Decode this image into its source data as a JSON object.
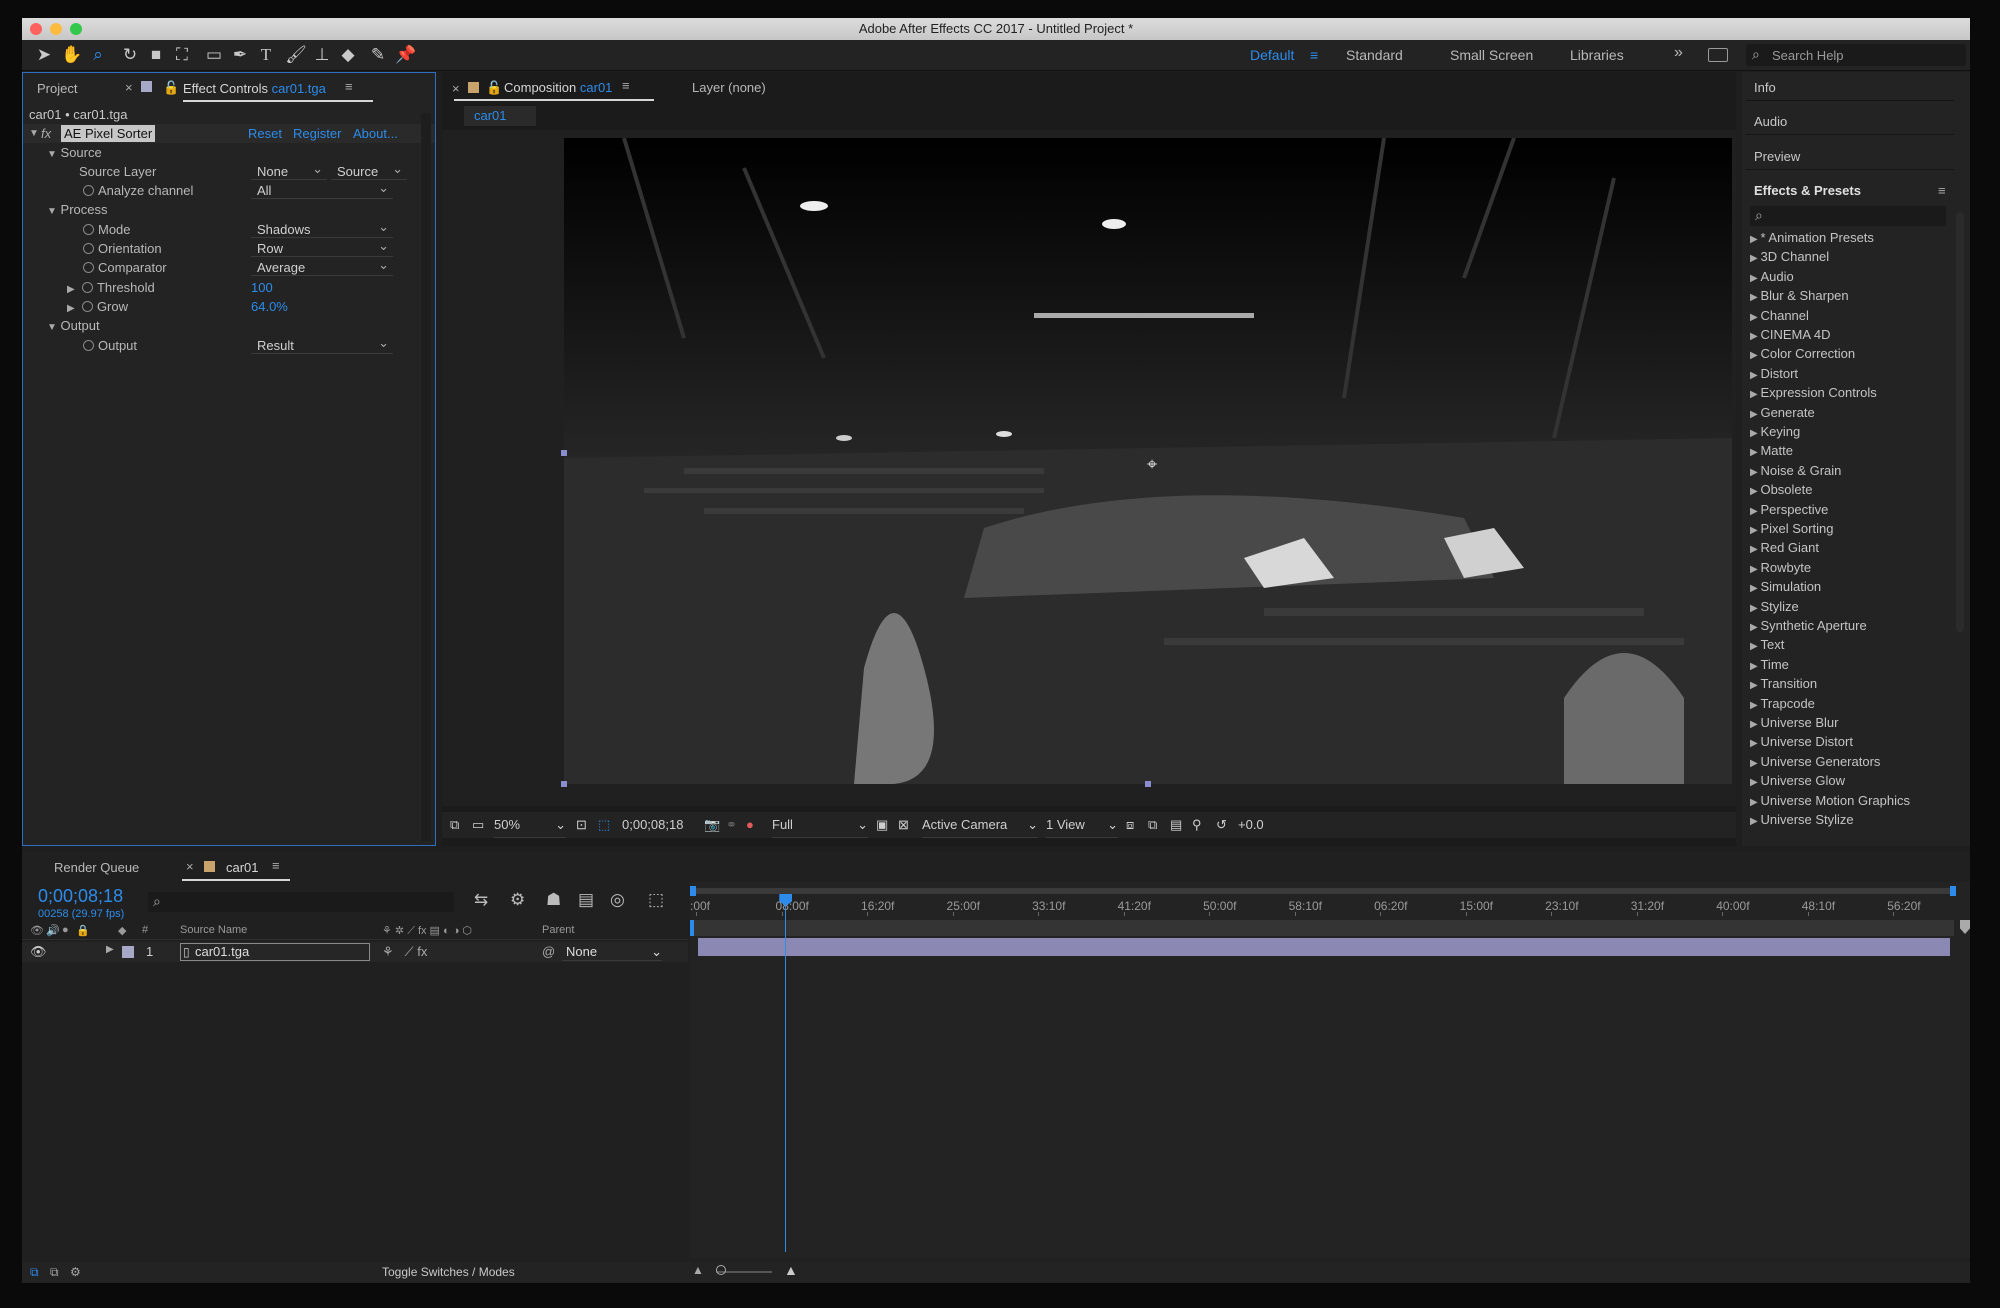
{
  "app": {
    "title": "Adobe After Effects CC 2017 - Untitled Project *",
    "traffic_lights": {
      "close": "#fc615d",
      "minimize": "#fdbc40",
      "zoom": "#34c84a"
    }
  },
  "toolbar": {
    "tools": [
      "selection-tool-icon",
      "hand-tool-icon",
      "zoom-tool-icon",
      "rotate-tool-icon",
      "camera-tool-icon",
      "pan-behind-tool-icon",
      "rectangle-tool-icon",
      "pen-tool-icon",
      "type-tool-icon",
      "brush-tool-icon",
      "clone-stamp-tool-icon",
      "eraser-tool-icon",
      "roto-brush-tool-icon",
      "puppet-pin-tool-icon"
    ],
    "type_tool_label": "T",
    "workspaces": [
      "Default",
      "Standard",
      "Small Screen",
      "Libraries"
    ],
    "active_workspace": "Default",
    "workspace_menu_icon": "≡",
    "overflow": "»",
    "search_placeholder": "Search Help"
  },
  "left_panel": {
    "tab_project": "Project",
    "tab_effect_controls_prefix": "Effect Controls",
    "tab_effect_controls_layer": "car01.tga",
    "breadcrumb": "car01 • car01.tga",
    "effect_name": "AE Pixel Sorter",
    "reset": "Reset",
    "register": "Register",
    "about": "About...",
    "groups": {
      "source": "Source",
      "process": "Process",
      "output": "Output"
    },
    "params": {
      "source_layer_label": "Source Layer",
      "source_layer_value": "None",
      "source_layer_option": "Source",
      "analyze_label": "Analyze channel",
      "analyze_value": "All",
      "mode_label": "Mode",
      "mode_value": "Shadows",
      "orientation_label": "Orientation",
      "orientation_value": "Row",
      "comparator_label": "Comparator",
      "comparator_value": "Average",
      "threshold_label": "Threshold",
      "threshold_value": "100",
      "grow_label": "Grow",
      "grow_value": "64.0%",
      "output_label": "Output",
      "output_value": "Result"
    }
  },
  "viewer": {
    "tab_composition_prefix": "Composition",
    "tab_composition_name": "car01",
    "tab_layer": "Layer (none)",
    "comp_button": "car01",
    "footer": {
      "zoom": "50%",
      "timecode": "0;00;08;18",
      "resolution": "Full",
      "camera": "Active Camera",
      "views": "1 View",
      "exposure": "+0.0"
    }
  },
  "right_panel": {
    "items": [
      "Info",
      "Audio",
      "Preview"
    ],
    "effects_title": "Effects & Presets",
    "categories": [
      "* Animation Presets",
      "3D Channel",
      "Audio",
      "Blur & Sharpen",
      "Channel",
      "CINEMA 4D",
      "Color Correction",
      "Distort",
      "Expression Controls",
      "Generate",
      "Keying",
      "Matte",
      "Noise & Grain",
      "Obsolete",
      "Perspective",
      "Pixel Sorting",
      "Red Giant",
      "Rowbyte",
      "Simulation",
      "Stylize",
      "Synthetic Aperture",
      "Text",
      "Time",
      "Transition",
      "Trapcode",
      "Universe Blur",
      "Universe Distort",
      "Universe Generators",
      "Universe Glow",
      "Universe Motion Graphics",
      "Universe Stylize"
    ]
  },
  "timeline": {
    "tab_render_queue": "Render Queue",
    "tab_comp": "car01",
    "timecode": "0;00;08;18",
    "frames": "00258 (29.97 fps)",
    "col_hash": "#",
    "col_source_name": "Source Name",
    "col_parent": "Parent",
    "layer_index": "1",
    "layer_name": "car01.tga",
    "parent_value": "None",
    "ruler_ticks": [
      ":00f",
      "08:00f",
      "16:20f",
      "25:00f",
      "33:10f",
      "41:20f",
      "50:00f",
      "58:10f",
      "06:20f",
      "15:00f",
      "23:10f",
      "31:20f",
      "40:00f",
      "48:10f",
      "56:20f"
    ],
    "playhead_fraction": 0.072,
    "toggle_label": "Toggle Switches / Modes"
  },
  "colors": {
    "accent": "#2d8ceb",
    "panel_bg": "#232323",
    "layer_bar": "#8c88b4"
  }
}
